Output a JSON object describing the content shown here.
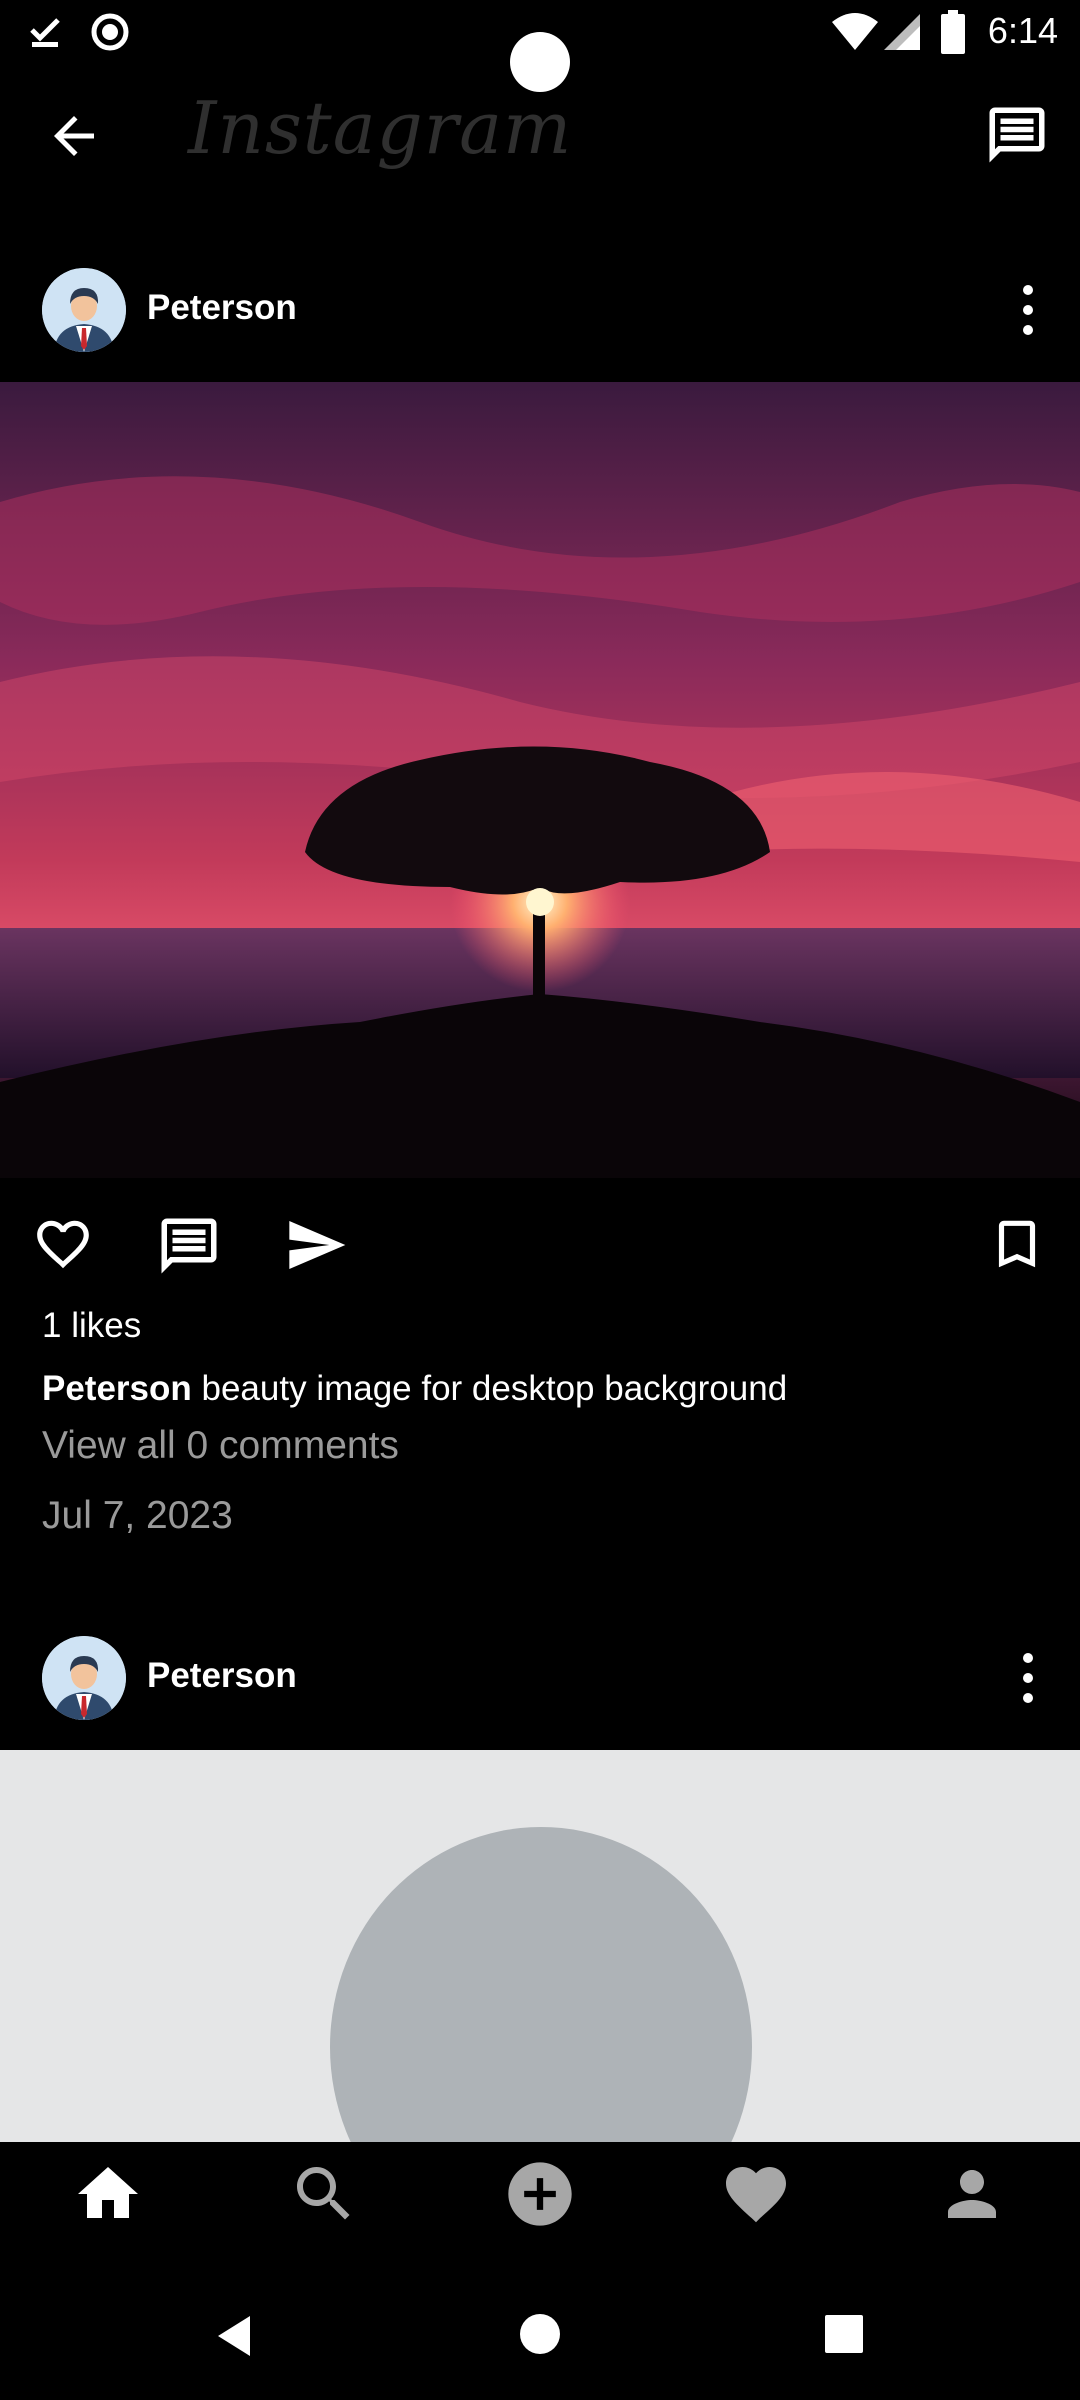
{
  "status_bar": {
    "time": "6:14"
  },
  "app": {
    "title": "Instagram"
  },
  "posts": [
    {
      "username": "Peterson",
      "likes": "1 likes",
      "caption_user": "Peterson",
      "caption_text": " beauty image for desktop background",
      "comments_link": "View all 0 comments",
      "date": "Jul 7, 2023"
    },
    {
      "username": "Peterson"
    }
  ],
  "icons": {
    "back": "arrow-left-icon",
    "messages": "chat-icon",
    "like": "heart-outline-icon",
    "comment": "comment-icon",
    "share": "send-icon",
    "save": "bookmark-icon",
    "more": "more-vertical-icon"
  },
  "bottom_nav": [
    "home-icon",
    "search-icon",
    "add-post-icon",
    "activity-icon",
    "profile-icon"
  ],
  "colors": {
    "background": "#000000",
    "muted_text": "#9a9a9a",
    "nav_active": "#ffffff",
    "nav_inactive": "#a7a7a7"
  }
}
